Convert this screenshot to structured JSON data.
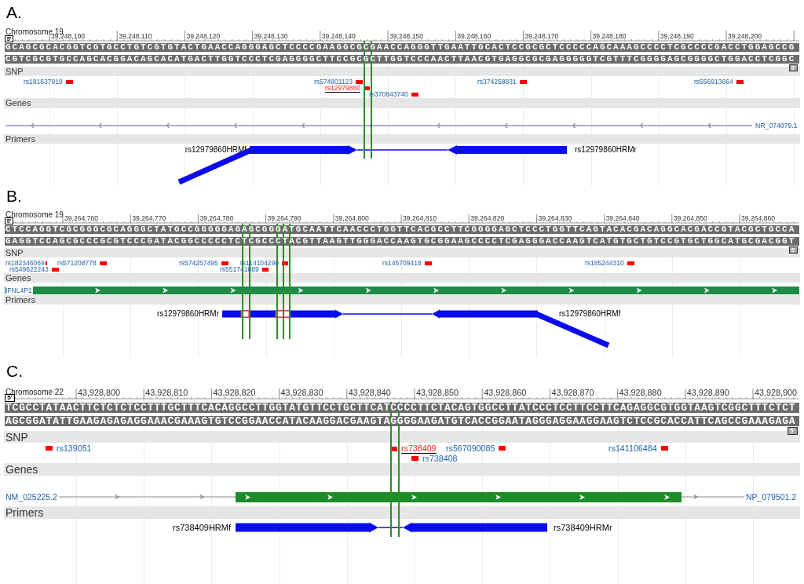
{
  "panels": [
    {
      "letter": "A.",
      "chromosome": "Chromosome 19",
      "ruler": [
        "39,248,100",
        "39,248,110",
        "39,248,120",
        "39,248,130",
        "39,248,140",
        "39,248,150",
        "39,248,160",
        "39,248,170",
        "39,248,180",
        "39,248,190",
        "39,248,200"
      ],
      "sequence": {
        "start_tag": "5'",
        "forward": "GCAGCGCACGGTCGTGCCTGTCGTGTACTGAACCAGGGAGCTCCCCGAAGGCGCGAACCAGGGTTGAATTGCACTCCGCGCTCCCCCAGCAAAGCCCCTCGCCCCGACCTGGAGCCG",
        "reverse": "CGTCGCGTGCCAGCACGGACAGCACATGACTTGGTCCCTCGAGGGGCTTCCGCGCTTGGTCCCAACTTAACGTGAGGCGCGAGGGGGTCGTTTCGGGGAGCGGGGCTGGACCTCGGC",
        "end_tag": "5'"
      },
      "snp_track": {
        "title": "SNP",
        "items": [
          {
            "name": "rs181637919",
            "selected": false
          },
          {
            "name": "rs574801123",
            "selected": false
          },
          {
            "name": "rs12979860",
            "selected": true
          },
          {
            "name": "rs370843740",
            "selected": false
          },
          {
            "name": "rs374258831",
            "selected": false
          },
          {
            "name": "rs556913664",
            "selected": false
          }
        ]
      },
      "gene_track": {
        "title": "Genes",
        "gene": {
          "kind": "line",
          "reverse": true,
          "labels": [
            "NR_074079.1"
          ]
        }
      },
      "primer_track": {
        "title": "Primers",
        "labels": [
          "rs12979860HRMf",
          "rs12979860HRMr"
        ]
      }
    },
    {
      "letter": "B.",
      "chromosome": "Chromosome 19",
      "ruler": [
        "39,264,760",
        "39,264,770",
        "39,264,780",
        "39,264,790",
        "39,264,800",
        "39,264,810",
        "39,264,820",
        "39,264,830",
        "39,264,840",
        "39,264,850",
        "39,264,860"
      ],
      "sequence": {
        "start_tag": "5'",
        "forward": "CTCCAGGTCGCGGGCGCAGGGCTATGCCGGGGGAGAGCGGGATGCAATTCAACCCTGGTTCACGCCTTCGGGGAGCTCCCTGGTTCAGTACACGACAGGCACGACCGTACGCTGCCA",
        "reverse": "GAGGTCCAGCGCCCGCGTCCCGATACGGCCCCCTCTCGCCCTACGTTAAGTTGGGACCAAGTGCGGAAGCCCCTCGAGGGACCAAGTCATGTGCTGTCCGTGCTGGCATGCGACGGT",
        "end_tag": "5'"
      },
      "snp_track": {
        "title": "SNP",
        "items": [
          {
            "name": "rs182346069",
            "selected": false
          },
          {
            "name": "rs549622243",
            "selected": false
          },
          {
            "name": "rs571208778",
            "selected": false
          },
          {
            "name": "rs574257495",
            "selected": false
          },
          {
            "name": "rs551741889",
            "selected": false
          },
          {
            "name": "rs114104290",
            "selected": false
          },
          {
            "name": "rs146709418",
            "selected": false
          },
          {
            "name": "rs185244310",
            "selected": false
          }
        ]
      },
      "gene_track": {
        "title": "Genes",
        "gene": {
          "kind": "bar",
          "reverse": false,
          "labels": [
            "IFNL4P1"
          ]
        }
      },
      "primer_track": {
        "title": "Primers",
        "labels": [
          "rs12979860HRMr",
          "rs12979860HRMf"
        ]
      }
    },
    {
      "letter": "C.",
      "chromosome": "Chromosome 22",
      "ruler": [
        "43,928,800",
        "43,928,810",
        "43,928,820",
        "43,928,830",
        "43,928,840",
        "43,928,850",
        "43,928,860",
        "43,928,870",
        "43,928,880",
        "43,928,890",
        "43,928,900"
      ],
      "sequence": {
        "start_tag": "5'",
        "forward": "TCGCCTATAACTTCTCTCTCCTTTGCTTTCACAGGCCTTGGTATGTTCCTGCTTCATCCCCTTCTACAGTGGCCTTATCCCTCCTTCCTTCAGAGGCGTGGTAAGTCGGCTTTCTCT",
        "reverse": "AGCGGATATTGAAGAGAGAGGAAACGAAAGTGTCCGGAACCATACAAGGACGAAGTAGGGGAAGATGTCACCGGAATAGGGAGGAAGGAAGTCTCCGCACCATTCAGCCGAAAGAGA",
        "end_tag": "5'"
      },
      "snp_track": {
        "title": "SNP",
        "items": [
          {
            "name": "rs139051",
            "selected": false
          },
          {
            "name": "rs738409",
            "selected": true
          },
          {
            "name": "rs738408",
            "selected": false
          },
          {
            "name": "rs567090085",
            "selected": false
          },
          {
            "name": "rs141106484",
            "selected": false
          }
        ]
      },
      "gene_track": {
        "title": "Genes",
        "gene": {
          "kind": "line_with_bar",
          "reverse": false,
          "labels": [
            "NM_025225.2",
            "NP_079501.2"
          ]
        }
      },
      "primer_track": {
        "title": "Primers",
        "labels": [
          "rs738409HRMf",
          "rs738409HRMr"
        ]
      }
    }
  ]
}
